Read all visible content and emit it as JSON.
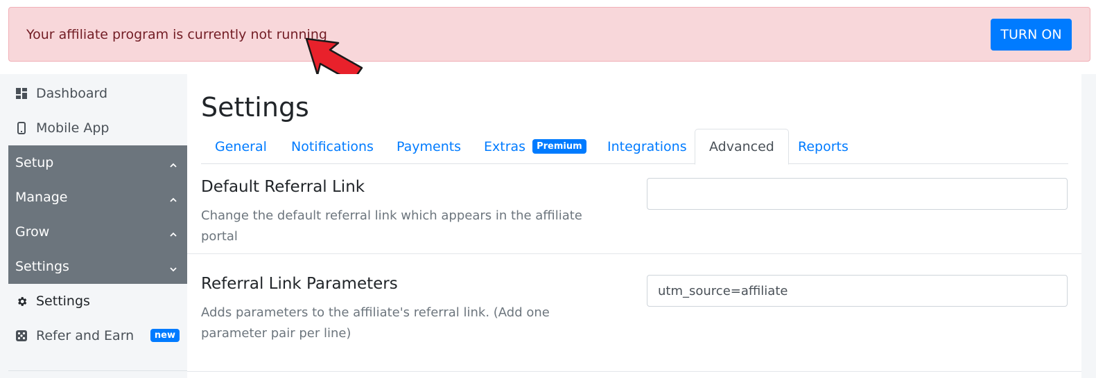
{
  "alert": {
    "message": "Your affiliate program is currently not running",
    "button_label": "TURN ON"
  },
  "sidebar": {
    "items": [
      {
        "label": "Dashboard",
        "icon": "dashboard-icon"
      },
      {
        "label": "Mobile App",
        "icon": "mobile-phone-icon"
      },
      {
        "label": "Setup",
        "icon": "chevron-up-icon"
      },
      {
        "label": "Manage",
        "icon": "chevron-up-icon"
      },
      {
        "label": "Grow",
        "icon": "chevron-up-icon"
      },
      {
        "label": "Settings",
        "icon": "chevron-down-icon"
      },
      {
        "label": "Settings",
        "icon": "gear-icon"
      },
      {
        "label": "Refer and Earn",
        "icon": "dice-icon",
        "badge": "new"
      }
    ]
  },
  "main": {
    "title": "Settings",
    "tabs": [
      {
        "label": "General"
      },
      {
        "label": "Notifications"
      },
      {
        "label": "Payments"
      },
      {
        "label": "Extras",
        "badge": "Premium"
      },
      {
        "label": "Integrations"
      },
      {
        "label": "Advanced",
        "active": true
      },
      {
        "label": "Reports"
      }
    ],
    "fields": [
      {
        "title": "Default Referral Link",
        "description": "Change the default referral link which appears in the affiliate portal",
        "value": ""
      },
      {
        "title": "Referral Link Parameters",
        "description": "Adds parameters to the affiliate's referral link. (Add one parameter pair per line)",
        "value": "utm_source=affiliate"
      }
    ]
  },
  "colors": {
    "primary": "#007bff",
    "alert_bg": "#f8d7da",
    "alert_text": "#721c24",
    "sidebar_section": "#6c757d",
    "arrow": "#e8212b"
  }
}
